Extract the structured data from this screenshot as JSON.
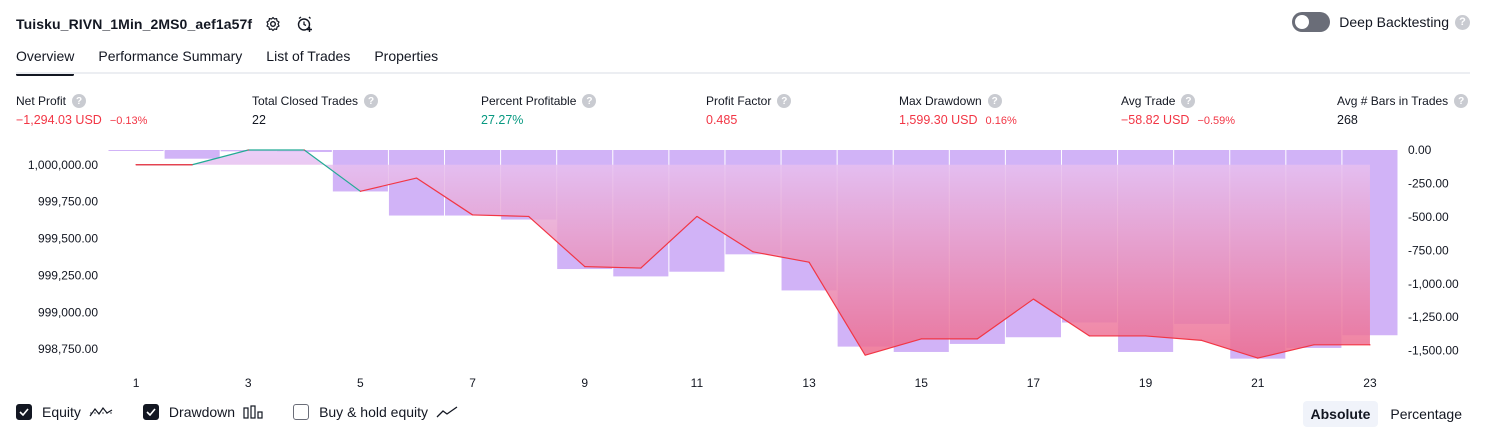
{
  "header": {
    "strategy_name": "Tuisku_RIVN_1Min_2MS0_aef1a57f",
    "deep_backtesting_label": "Deep Backtesting",
    "deep_backtesting_enabled": false
  },
  "tabs": [
    {
      "label": "Overview",
      "active": true
    },
    {
      "label": "Performance Summary",
      "active": false
    },
    {
      "label": "List of Trades",
      "active": false
    },
    {
      "label": "Properties",
      "active": false
    }
  ],
  "metrics": [
    {
      "label": "Net Profit",
      "value": "−1,294.03 USD",
      "pct": "−0.13%",
      "tone": "neg"
    },
    {
      "label": "Total Closed Trades",
      "value": "22",
      "pct": "",
      "tone": "neu"
    },
    {
      "label": "Percent Profitable",
      "value": "27.27%",
      "pct": "",
      "tone": "pos"
    },
    {
      "label": "Profit Factor",
      "value": "0.485",
      "pct": "",
      "tone": "neg"
    },
    {
      "label": "Max Drawdown",
      "value": "1,599.30 USD",
      "pct": "0.16%",
      "tone": "neg"
    },
    {
      "label": "Avg Trade",
      "value": "−58.82 USD",
      "pct": "−0.59%",
      "tone": "neg"
    },
    {
      "label": "Avg # Bars in Trades",
      "value": "268",
      "pct": "",
      "tone": "neu"
    }
  ],
  "chart_data": {
    "type": "line",
    "x": [
      1,
      2,
      3,
      4,
      5,
      6,
      7,
      8,
      9,
      10,
      11,
      12,
      13,
      14,
      15,
      16,
      17,
      18,
      19,
      20,
      21,
      22,
      23
    ],
    "x_ticks": [
      "1",
      "3",
      "5",
      "7",
      "9",
      "11",
      "13",
      "15",
      "17",
      "19",
      "21",
      "23"
    ],
    "left_axis": {
      "ticks": [
        "1,000,000.00",
        "999,750.00",
        "999,500.00",
        "999,250.00",
        "999,000.00",
        "998,750.00"
      ],
      "ylim": [
        998650,
        1000100
      ]
    },
    "right_axis": {
      "ticks": [
        "0.00",
        "-250.00",
        "-500.00",
        "-750.00",
        "-1,000.00",
        "-1,250.00",
        "-1,500.00"
      ],
      "ylim": [
        -1600,
        0
      ]
    },
    "series": [
      {
        "name": "Equity",
        "axis": "left",
        "values": [
          1000000,
          1000000,
          1000100,
          1000100,
          999820,
          999910,
          999660,
          999650,
          999310,
          999300,
          999650,
          999410,
          999340,
          998710,
          998820,
          998820,
          999090,
          998840,
          998840,
          998810,
          998690,
          998780,
          998780
        ]
      },
      {
        "name": "Drawdown",
        "axis": "right",
        "values": [
          0,
          -65,
          -10,
          -15,
          -310,
          -490,
          -490,
          -520,
          -890,
          -945,
          -910,
          -780,
          -1050,
          -1470,
          -1510,
          -1450,
          -1400,
          -1290,
          -1510,
          -1300,
          -1560,
          -1480,
          -1385
        ]
      }
    ],
    "colors": {
      "equity_line": "#f23645",
      "equity_up_line": "#22ab94",
      "baseline_line": "#9598a1",
      "drawdown_bar": "#d1b3f7",
      "equity_fill_top": "#e6c6f7",
      "equity_fill_bottom": "#ee6a8c"
    }
  },
  "legend": {
    "equity_label": "Equity",
    "equity_checked": true,
    "drawdown_label": "Drawdown",
    "drawdown_checked": true,
    "buyhold_label": "Buy & hold equity",
    "buyhold_checked": false
  },
  "modes": [
    {
      "label": "Absolute",
      "active": true
    },
    {
      "label": "Percentage",
      "active": false
    }
  ]
}
